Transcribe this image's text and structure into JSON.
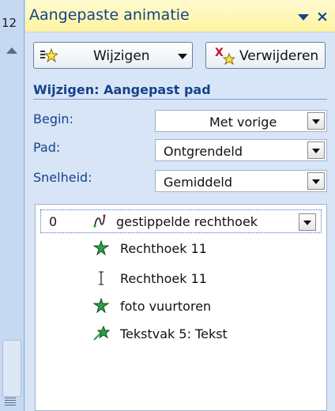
{
  "strip": {
    "slide_number": "12"
  },
  "pane": {
    "title": "Aangepaste animatie",
    "close": "×"
  },
  "toolbar": {
    "change_label": "Wijzigen",
    "remove_label": "Verwijderen"
  },
  "section": {
    "title": "Wijzigen: Aangepast pad",
    "fields": [
      {
        "label": "Begin:",
        "value": "Met vorige"
      },
      {
        "label": "Pad:",
        "value": "Ontgrendeld"
      },
      {
        "label": "Snelheid:",
        "value": "Gemiddeld"
      }
    ]
  },
  "list": {
    "items": [
      {
        "index": "0",
        "label": "gestippelde rechthoek",
        "icon": "motion-path-icon",
        "selected": true
      },
      {
        "label": "Rechthoek 11",
        "icon": "green-star-icon"
      },
      {
        "label": "Rechthoek 11",
        "icon": "ibeam-icon"
      },
      {
        "label": "foto vuurtoren",
        "icon": "green-star-icon"
      },
      {
        "label": "Tekstvak 5: Tekst",
        "icon": "fly-in-star-icon"
      }
    ]
  }
}
